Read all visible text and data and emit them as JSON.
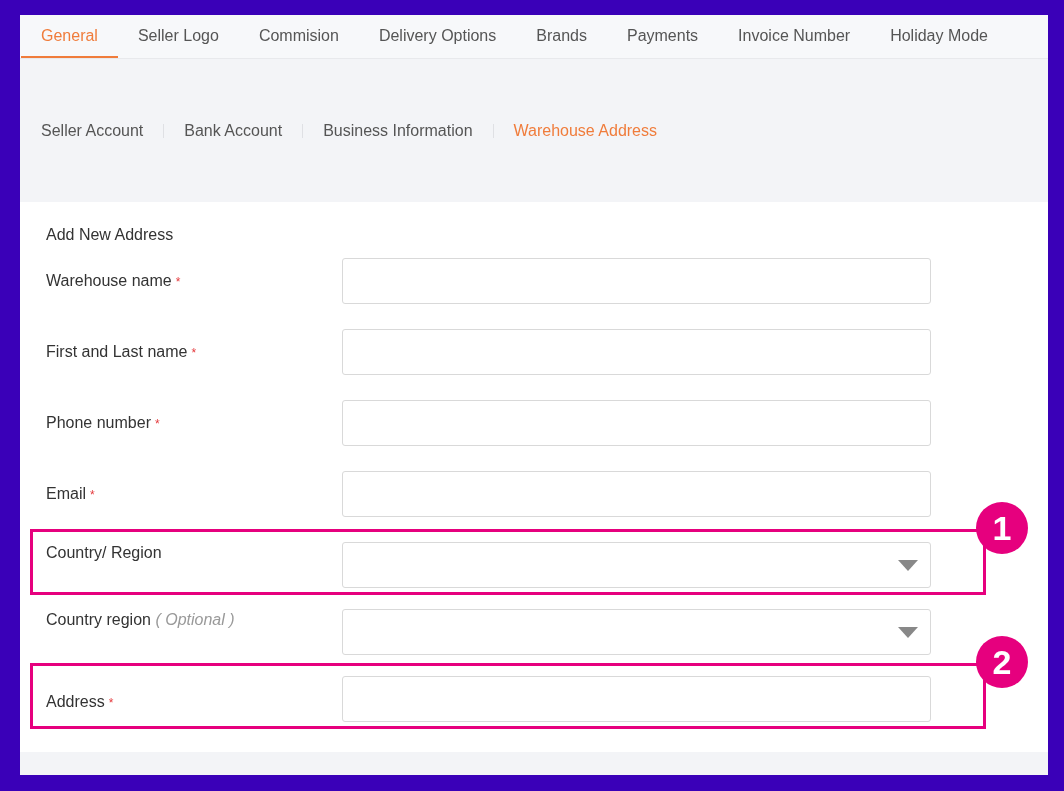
{
  "tabs": [
    {
      "label": "General",
      "selected": true
    },
    {
      "label": "Seller Logo",
      "selected": false
    },
    {
      "label": "Commision",
      "selected": false
    },
    {
      "label": "Delivery Options",
      "selected": false
    },
    {
      "label": "Brands",
      "selected": false
    },
    {
      "label": "Payments",
      "selected": false
    },
    {
      "label": "Invoice Number",
      "selected": false
    },
    {
      "label": "Holiday Mode",
      "selected": false
    }
  ],
  "subnav": [
    {
      "label": "Seller Account",
      "selected": false
    },
    {
      "label": "Bank Account",
      "selected": false
    },
    {
      "label": "Business Information",
      "selected": false
    },
    {
      "label": "Warehouse Address",
      "selected": true
    }
  ],
  "form": {
    "title": "Add New Address",
    "fields": [
      {
        "kind": "text",
        "label": "Warehouse name",
        "required_mark": "*"
      },
      {
        "kind": "text",
        "label": "First and Last name",
        "required_mark": "*"
      },
      {
        "kind": "text",
        "label": "Phone number",
        "required_mark": "*"
      },
      {
        "kind": "text",
        "label": "Email",
        "required_mark": "*"
      },
      {
        "kind": "select",
        "label": "Country/ Region",
        "callout": "1"
      },
      {
        "kind": "select",
        "label": "Country region",
        "optional_note": "( Optional )"
      },
      {
        "kind": "text",
        "label": "Address",
        "required_mark": "*",
        "callout": "2"
      }
    ]
  }
}
